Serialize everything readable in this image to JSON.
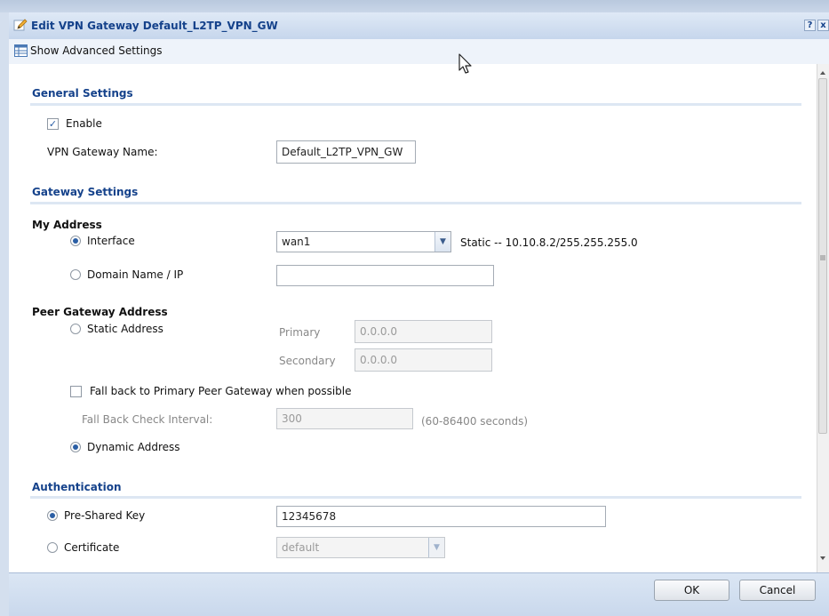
{
  "window": {
    "title": "Edit VPN Gateway Default_L2TP_VPN_GW",
    "help_label": "?",
    "close_label": "x"
  },
  "toolbar": {
    "advanced_label": "Show Advanced Settings"
  },
  "general": {
    "heading": "General Settings",
    "enable_label": "Enable",
    "enable_checked": true,
    "name_label": "VPN Gateway Name:",
    "name_value": "Default_L2TP_VPN_GW"
  },
  "gateway": {
    "heading": "Gateway Settings",
    "my_address": {
      "heading": "My Address",
      "interface_label": "Interface",
      "interface_value": "wan1",
      "interface_info": "Static -- 10.10.8.2/255.255.255.0",
      "domain_label": "Domain Name / IP",
      "domain_value": ""
    },
    "peer": {
      "heading": "Peer Gateway Address",
      "static_label": "Static Address",
      "primary_label": "Primary",
      "primary_value": "0.0.0.0",
      "secondary_label": "Secondary",
      "secondary_value": "0.0.0.0",
      "fallback_label": "Fall back to Primary Peer Gateway when possible",
      "fallback_checked": false,
      "interval_label": "Fall Back Check Interval:",
      "interval_value": "300",
      "interval_hint": "(60-86400 seconds)",
      "dynamic_label": "Dynamic Address"
    }
  },
  "auth": {
    "heading": "Authentication",
    "psk_label": "Pre-Shared Key",
    "psk_value": "12345678",
    "cert_label": "Certificate",
    "cert_value": "default"
  },
  "footer": {
    "ok_label": "OK",
    "cancel_label": "Cancel"
  },
  "colors": {
    "heading": "#15428b",
    "titlebar": "#c6d6ec",
    "accent": "#2b5fa5"
  },
  "icons": {
    "title": "edit-pencil-icon",
    "toolbar": "table-icon"
  }
}
